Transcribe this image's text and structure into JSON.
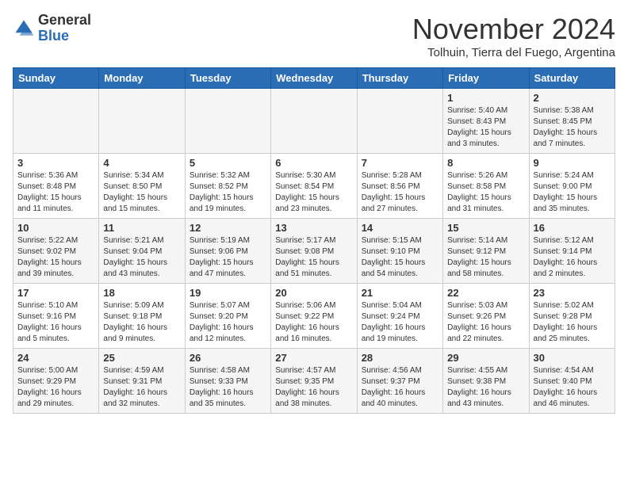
{
  "header": {
    "logo_general": "General",
    "logo_blue": "Blue",
    "month_title": "November 2024",
    "location": "Tolhuin, Tierra del Fuego, Argentina"
  },
  "weekdays": [
    "Sunday",
    "Monday",
    "Tuesday",
    "Wednesday",
    "Thursday",
    "Friday",
    "Saturday"
  ],
  "weeks": [
    [
      {
        "day": "",
        "info": ""
      },
      {
        "day": "",
        "info": ""
      },
      {
        "day": "",
        "info": ""
      },
      {
        "day": "",
        "info": ""
      },
      {
        "day": "",
        "info": ""
      },
      {
        "day": "1",
        "info": "Sunrise: 5:40 AM\nSunset: 8:43 PM\nDaylight: 15 hours\nand 3 minutes."
      },
      {
        "day": "2",
        "info": "Sunrise: 5:38 AM\nSunset: 8:45 PM\nDaylight: 15 hours\nand 7 minutes."
      }
    ],
    [
      {
        "day": "3",
        "info": "Sunrise: 5:36 AM\nSunset: 8:48 PM\nDaylight: 15 hours\nand 11 minutes."
      },
      {
        "day": "4",
        "info": "Sunrise: 5:34 AM\nSunset: 8:50 PM\nDaylight: 15 hours\nand 15 minutes."
      },
      {
        "day": "5",
        "info": "Sunrise: 5:32 AM\nSunset: 8:52 PM\nDaylight: 15 hours\nand 19 minutes."
      },
      {
        "day": "6",
        "info": "Sunrise: 5:30 AM\nSunset: 8:54 PM\nDaylight: 15 hours\nand 23 minutes."
      },
      {
        "day": "7",
        "info": "Sunrise: 5:28 AM\nSunset: 8:56 PM\nDaylight: 15 hours\nand 27 minutes."
      },
      {
        "day": "8",
        "info": "Sunrise: 5:26 AM\nSunset: 8:58 PM\nDaylight: 15 hours\nand 31 minutes."
      },
      {
        "day": "9",
        "info": "Sunrise: 5:24 AM\nSunset: 9:00 PM\nDaylight: 15 hours\nand 35 minutes."
      }
    ],
    [
      {
        "day": "10",
        "info": "Sunrise: 5:22 AM\nSunset: 9:02 PM\nDaylight: 15 hours\nand 39 minutes."
      },
      {
        "day": "11",
        "info": "Sunrise: 5:21 AM\nSunset: 9:04 PM\nDaylight: 15 hours\nand 43 minutes."
      },
      {
        "day": "12",
        "info": "Sunrise: 5:19 AM\nSunset: 9:06 PM\nDaylight: 15 hours\nand 47 minutes."
      },
      {
        "day": "13",
        "info": "Sunrise: 5:17 AM\nSunset: 9:08 PM\nDaylight: 15 hours\nand 51 minutes."
      },
      {
        "day": "14",
        "info": "Sunrise: 5:15 AM\nSunset: 9:10 PM\nDaylight: 15 hours\nand 54 minutes."
      },
      {
        "day": "15",
        "info": "Sunrise: 5:14 AM\nSunset: 9:12 PM\nDaylight: 15 hours\nand 58 minutes."
      },
      {
        "day": "16",
        "info": "Sunrise: 5:12 AM\nSunset: 9:14 PM\nDaylight: 16 hours\nand 2 minutes."
      }
    ],
    [
      {
        "day": "17",
        "info": "Sunrise: 5:10 AM\nSunset: 9:16 PM\nDaylight: 16 hours\nand 5 minutes."
      },
      {
        "day": "18",
        "info": "Sunrise: 5:09 AM\nSunset: 9:18 PM\nDaylight: 16 hours\nand 9 minutes."
      },
      {
        "day": "19",
        "info": "Sunrise: 5:07 AM\nSunset: 9:20 PM\nDaylight: 16 hours\nand 12 minutes."
      },
      {
        "day": "20",
        "info": "Sunrise: 5:06 AM\nSunset: 9:22 PM\nDaylight: 16 hours\nand 16 minutes."
      },
      {
        "day": "21",
        "info": "Sunrise: 5:04 AM\nSunset: 9:24 PM\nDaylight: 16 hours\nand 19 minutes."
      },
      {
        "day": "22",
        "info": "Sunrise: 5:03 AM\nSunset: 9:26 PM\nDaylight: 16 hours\nand 22 minutes."
      },
      {
        "day": "23",
        "info": "Sunrise: 5:02 AM\nSunset: 9:28 PM\nDaylight: 16 hours\nand 25 minutes."
      }
    ],
    [
      {
        "day": "24",
        "info": "Sunrise: 5:00 AM\nSunset: 9:29 PM\nDaylight: 16 hours\nand 29 minutes."
      },
      {
        "day": "25",
        "info": "Sunrise: 4:59 AM\nSunset: 9:31 PM\nDaylight: 16 hours\nand 32 minutes."
      },
      {
        "day": "26",
        "info": "Sunrise: 4:58 AM\nSunset: 9:33 PM\nDaylight: 16 hours\nand 35 minutes."
      },
      {
        "day": "27",
        "info": "Sunrise: 4:57 AM\nSunset: 9:35 PM\nDaylight: 16 hours\nand 38 minutes."
      },
      {
        "day": "28",
        "info": "Sunrise: 4:56 AM\nSunset: 9:37 PM\nDaylight: 16 hours\nand 40 minutes."
      },
      {
        "day": "29",
        "info": "Sunrise: 4:55 AM\nSunset: 9:38 PM\nDaylight: 16 hours\nand 43 minutes."
      },
      {
        "day": "30",
        "info": "Sunrise: 4:54 AM\nSunset: 9:40 PM\nDaylight: 16 hours\nand 46 minutes."
      }
    ]
  ]
}
